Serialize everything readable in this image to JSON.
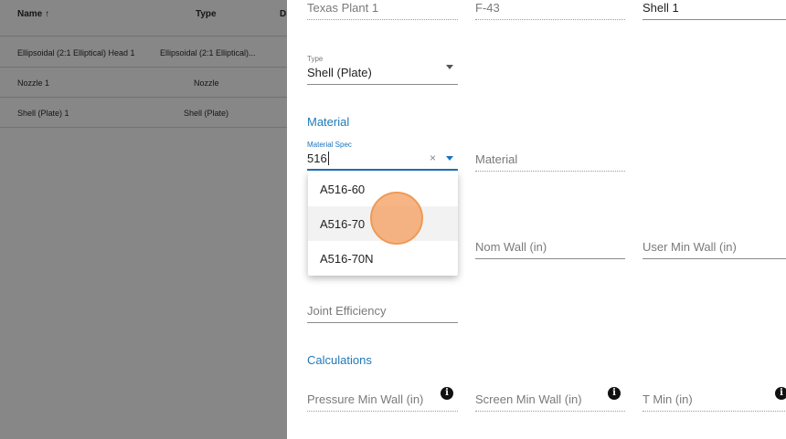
{
  "table": {
    "headers": {
      "name": "Name ↑",
      "type": "Type",
      "di": "Di"
    },
    "rows": [
      {
        "name": "Ellipsoidal (2:1 Elliptical) Head 1",
        "type": "Ellipsoidal (2:1 Elliptical)..."
      },
      {
        "name": "Nozzle 1",
        "type": "Nozzle"
      },
      {
        "name": "Shell (Plate) 1",
        "type": "Shell (Plate)"
      }
    ]
  },
  "form": {
    "top_fields": [
      "Texas Plant 1",
      "F-43",
      "Shell 1"
    ],
    "type": {
      "label": "Type",
      "value": "Shell (Plate)"
    },
    "material_section": "Material",
    "material_spec": {
      "label": "Material Spec",
      "value": "516",
      "clear_icon": "×"
    },
    "material_placeholder": "Material",
    "nom_wall": "Nom Wall (in)",
    "user_min_wall": "User Min Wall (in)",
    "joint_efficiency": "Joint Efficiency",
    "calculations_section": "Calculations",
    "pressure_min_wall": "Pressure Min Wall (in)",
    "screen_min_wall": "Screen Min Wall (in)",
    "t_min": "T Min (in)",
    "info_glyph": "i"
  },
  "dropdown": {
    "options": [
      "A516-60",
      "A516-70",
      "A516-70N"
    ],
    "highlighted": "A516-70"
  },
  "colors": {
    "accent": "#1e73be",
    "section": "#1f7ab8",
    "cursor": "#ee9a55"
  }
}
